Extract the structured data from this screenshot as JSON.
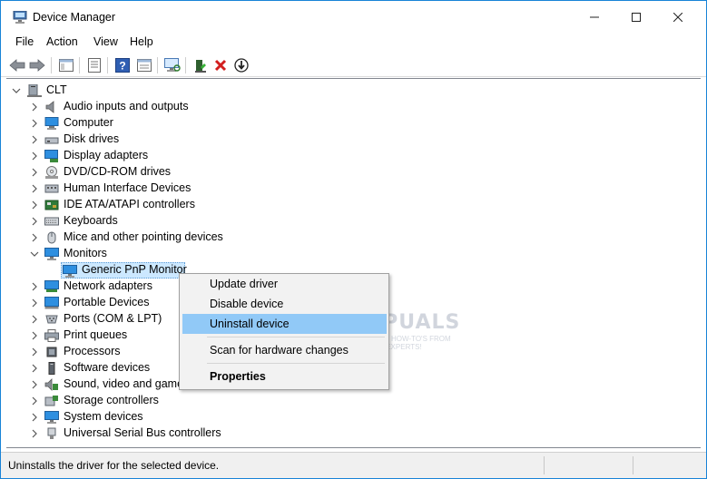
{
  "window": {
    "title": "Device Manager",
    "minimize_glyph": "—",
    "maximize_glyph": "☐",
    "close_glyph": "✕"
  },
  "menu": {
    "items": [
      {
        "label": "File"
      },
      {
        "label": "Action"
      },
      {
        "label": "View"
      },
      {
        "label": "Help"
      }
    ]
  },
  "toolbar": {
    "icons": [
      "back-arrow-icon",
      "forward-arrow-icon",
      "show-hide-console-tree-icon",
      "properties-icon",
      "help-icon",
      "console-view-icon",
      "monitor-scan-icon",
      "update-driver-icon",
      "uninstall-x-icon",
      "disable-device-icon"
    ]
  },
  "tree": {
    "root": {
      "label": "CLT",
      "expanded": true
    },
    "categories": [
      {
        "label": "Audio inputs and outputs",
        "icon": "speaker-icon"
      },
      {
        "label": "Computer",
        "icon": "computer-icon"
      },
      {
        "label": "Disk drives",
        "icon": "disk-drive-icon"
      },
      {
        "label": "Display adapters",
        "icon": "display-adapter-icon"
      },
      {
        "label": "DVD/CD-ROM drives",
        "icon": "dvd-drive-icon"
      },
      {
        "label": "Human Interface Devices",
        "icon": "hid-icon"
      },
      {
        "label": "IDE ATA/ATAPI controllers",
        "icon": "ide-controller-icon"
      },
      {
        "label": "Keyboards",
        "icon": "keyboard-icon"
      },
      {
        "label": "Mice and other pointing devices",
        "icon": "mouse-icon"
      },
      {
        "label": "Monitors",
        "icon": "monitor-icon",
        "expanded": true,
        "children": [
          {
            "label": "Generic PnP Monitor",
            "icon": "monitor-icon",
            "selected": true
          }
        ]
      },
      {
        "label": "Network adapters",
        "icon": "network-adapter-icon"
      },
      {
        "label": "Portable Devices",
        "icon": "portable-device-icon"
      },
      {
        "label": "Ports (COM & LPT)",
        "icon": "port-icon"
      },
      {
        "label": "Print queues",
        "icon": "printer-icon"
      },
      {
        "label": "Processors",
        "icon": "processor-icon"
      },
      {
        "label": "Software devices",
        "icon": "software-device-icon"
      },
      {
        "label": "Sound, video and game",
        "icon": "sound-video-icon"
      },
      {
        "label": "Storage controllers",
        "icon": "storage-controller-icon"
      },
      {
        "label": "System devices",
        "icon": "system-device-icon"
      },
      {
        "label": "Universal Serial Bus controllers",
        "icon": "usb-icon"
      }
    ]
  },
  "context_menu": {
    "items": [
      {
        "label": "Update driver"
      },
      {
        "label": "Disable device"
      },
      {
        "label": "Uninstall device",
        "highlighted": true
      },
      {
        "label": "Scan for hardware changes"
      },
      {
        "label": "Properties",
        "bold": true
      }
    ]
  },
  "watermark": {
    "text": "APPUALS",
    "sub": "TECH HOW-TO'S FROM THE EXPERTS!"
  },
  "status": {
    "text": "Uninstalls the driver for the selected device."
  },
  "colors": {
    "window_border": "#1883d7",
    "selection_bg": "#cce8ff",
    "context_highlight": "#91c9f7",
    "menu_bg": "#f2f2f2",
    "status_bg": "#f0f0f0"
  }
}
